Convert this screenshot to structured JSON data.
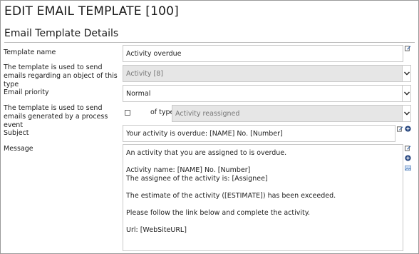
{
  "page_title": "EDIT EMAIL TEMPLATE [100]",
  "section_title": "Email Template Details",
  "fields": {
    "template_name": {
      "label": "Template name",
      "value": "Activity overdue"
    },
    "object_type": {
      "label": "The template is used to send emails regarding an object of this type",
      "value": "Activity [8]"
    },
    "priority": {
      "label": "Email priority",
      "value": "Normal"
    },
    "process_event": {
      "label": "The template is used to send emails generated by a process event",
      "of_type_label": "of type",
      "value": "Activity reassigned"
    },
    "subject": {
      "label": "Subject",
      "value": "Your activity is overdue: [NAME] No. [Number]"
    },
    "message": {
      "label": "Message",
      "value": "An activity that you are assigned to is overdue.\n\nActivity name: [NAME] No. [Number]\nThe assignee of the activity is: [Assignee]\n\nThe estimate of the activity ([ESTIMATE]) has been exceeded.\n\nPlease follow the link below and complete the activity.\n\nUrl: [WebSiteURL]"
    }
  },
  "icons": {
    "edit": "edit-icon",
    "add": "add-circle-icon",
    "image": "image-icon",
    "dropdown": "chevron-down-icon"
  },
  "colors": {
    "disabled_bg": "#e6e6e6",
    "border": "#c9c9c9",
    "icon_blue": "#2a5da8"
  }
}
